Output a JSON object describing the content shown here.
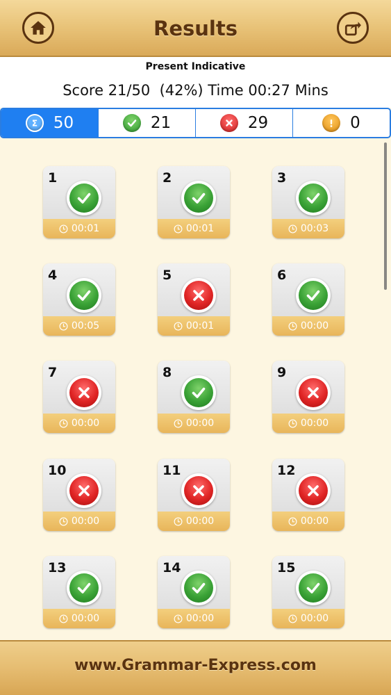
{
  "header": {
    "title": "Results",
    "home_icon": "home-icon",
    "share_icon": "share-icon"
  },
  "summary": {
    "mode": "Present Indicative",
    "score_line": "Score 21/50  (42%) Time 00:27 Mins"
  },
  "stats": {
    "total": "50",
    "correct": "21",
    "wrong": "29",
    "skipped": "0",
    "total_icon": "sigma-icon",
    "correct_icon": "check-icon",
    "wrong_icon": "x-icon",
    "skipped_icon": "exclamation-icon"
  },
  "questions": [
    {
      "num": "1",
      "result": "correct",
      "time": "00:01"
    },
    {
      "num": "2",
      "result": "correct",
      "time": "00:01"
    },
    {
      "num": "3",
      "result": "correct",
      "time": "00:03"
    },
    {
      "num": "4",
      "result": "correct",
      "time": "00:05"
    },
    {
      "num": "5",
      "result": "wrong",
      "time": "00:01"
    },
    {
      "num": "6",
      "result": "correct",
      "time": "00:00"
    },
    {
      "num": "7",
      "result": "wrong",
      "time": "00:00"
    },
    {
      "num": "8",
      "result": "correct",
      "time": "00:00"
    },
    {
      "num": "9",
      "result": "wrong",
      "time": "00:00"
    },
    {
      "num": "10",
      "result": "wrong",
      "time": "00:00"
    },
    {
      "num": "11",
      "result": "wrong",
      "time": "00:00"
    },
    {
      "num": "12",
      "result": "wrong",
      "time": "00:00"
    },
    {
      "num": "13",
      "result": "correct",
      "time": "00:00"
    },
    {
      "num": "14",
      "result": "correct",
      "time": "00:00"
    },
    {
      "num": "15",
      "result": "correct",
      "time": "00:00"
    }
  ],
  "footer": {
    "url": "www.Grammar-Express.com"
  },
  "colors": {
    "accent_blue": "#1f7ff1",
    "correct_green": "#3aa236",
    "wrong_red": "#e02525",
    "skipped_orange": "#f0a020",
    "wood": "#e9c47a"
  }
}
